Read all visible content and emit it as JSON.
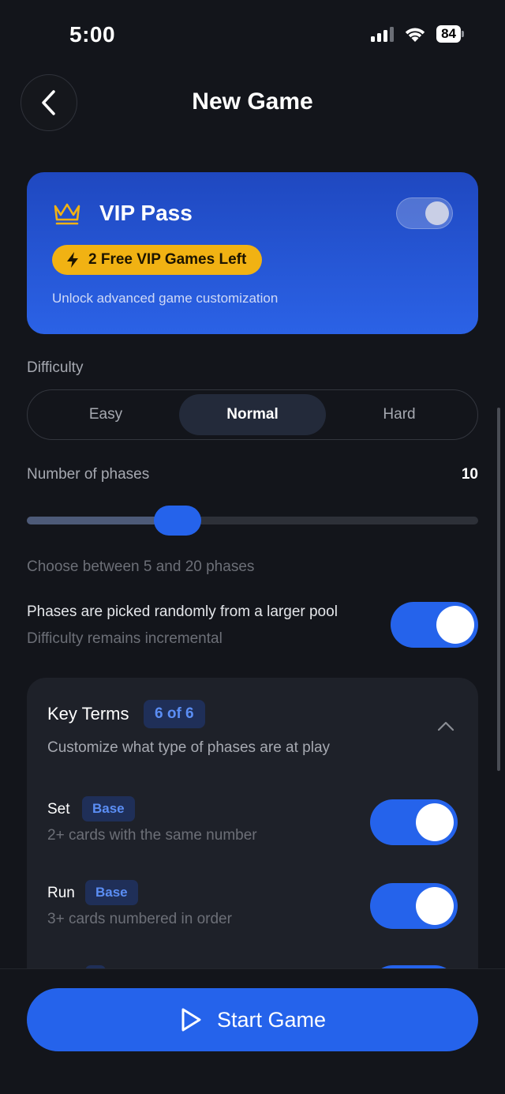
{
  "status_bar": {
    "time": "5:00",
    "battery": "84"
  },
  "header": {
    "title": "New Game"
  },
  "vip": {
    "title": "VIP Pass",
    "badge": "2 Free VIP Games Left",
    "subtitle": "Unlock advanced game customization",
    "toggle_on": true
  },
  "difficulty": {
    "label": "Difficulty",
    "options": [
      "Easy",
      "Normal",
      "Hard"
    ],
    "selected": "Normal"
  },
  "phases": {
    "label": "Number of phases",
    "value": "10",
    "min": 5,
    "max": 20,
    "hint": "Choose between 5 and 20 phases"
  },
  "random_pool": {
    "title": "Phases are picked randomly from a larger pool",
    "subtitle": "Difficulty remains incremental",
    "enabled": true
  },
  "key_terms": {
    "title": "Key Terms",
    "count": "6 of 6",
    "subtitle": "Customize what type of phases are at play",
    "items": [
      {
        "name": "Set",
        "badge": "Base",
        "description": "2+ cards with the same number",
        "enabled": true
      },
      {
        "name": "Run",
        "badge": "Base",
        "description": "3+ cards numbered in order",
        "enabled": true
      }
    ]
  },
  "footer": {
    "start_label": "Start Game"
  },
  "colors": {
    "accent": "#2563eb",
    "vip_badge": "#f1b213",
    "background": "#13151b"
  }
}
